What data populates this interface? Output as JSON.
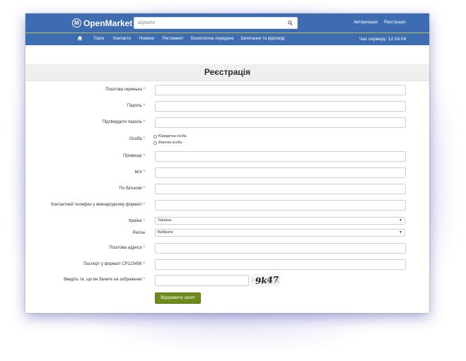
{
  "header": {
    "logo_text": "OpenMarket",
    "logo_letter": "M",
    "search_placeholder": "Шукати",
    "login_link": "Авторизація",
    "register_link": "Реєстрація"
  },
  "nav": {
    "items": [
      {
        "label": "Торги"
      },
      {
        "label": "Контакти"
      },
      {
        "label": "Новини"
      },
      {
        "label": "Регламент"
      },
      {
        "label": "Безоплатна передача"
      },
      {
        "label": "Запитання та відповіді"
      }
    ],
    "server_time": "Час серверу: 12:24:04"
  },
  "page": {
    "title": "Реєстрація"
  },
  "form": {
    "required_mark": "*",
    "labels": {
      "email": "Поштова скринька",
      "password": "Пароль",
      "confirm_password": "Підтвердити пароль",
      "person": "Особа",
      "surname": "Прізвище",
      "name": "Ім'я",
      "patronymic": "По батькові",
      "phone": "Контактний телефон у міжнародному форматі",
      "country": "Країна",
      "region": "Регіон",
      "postal_address": "Поштова адреса",
      "passport": "Паспорт у форматі СР123456",
      "captcha": "Введіть те, що ви бачите на зображенні"
    },
    "person_options": [
      "Юридична особа",
      "Фізична особа"
    ],
    "country_value": "Україна",
    "region_value": "Вибрати",
    "captcha_text": "9k47",
    "submit_label": "Відправити запит"
  },
  "colors": {
    "header_blue": "#3d6cb0",
    "required_red": "#d02b2b",
    "submit_green": "#6e8a1b"
  }
}
